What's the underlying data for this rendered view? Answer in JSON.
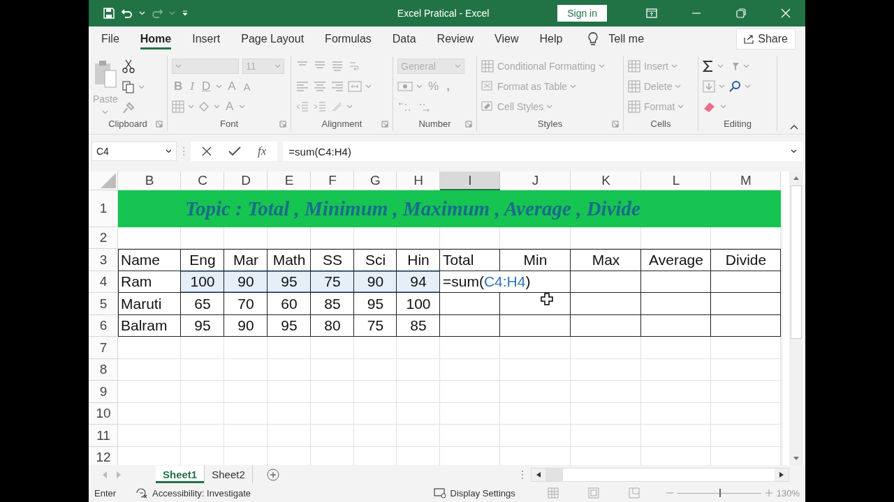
{
  "title_bar": {
    "title": "Excel Pratical  -  Excel",
    "sign_in": "Sign in"
  },
  "tabs": [
    {
      "label": "File",
      "selected": false
    },
    {
      "label": "Home",
      "selected": true
    },
    {
      "label": "Insert",
      "selected": false
    },
    {
      "label": "Page Layout",
      "selected": false
    },
    {
      "label": "Formulas",
      "selected": false
    },
    {
      "label": "Data",
      "selected": false
    },
    {
      "label": "Review",
      "selected": false
    },
    {
      "label": "View",
      "selected": false
    },
    {
      "label": "Help",
      "selected": false
    }
  ],
  "tell_me": "Tell me",
  "share": "Share",
  "ribbon": {
    "disabled": true,
    "paste": "Paste",
    "font_size": "11",
    "font_buttons": [
      "B",
      "I",
      "D",
      "A",
      "A"
    ],
    "font_color": "A",
    "number_format": "General",
    "percent": "%",
    "comma": ",",
    "styles": [
      "Conditional Formatting",
      "Format as Table",
      "Cell Styles"
    ],
    "cells": [
      "Insert",
      "Delete",
      "Format"
    ],
    "groups": [
      "Clipboard",
      "Font",
      "Alignment",
      "Number",
      "Styles",
      "Cells",
      "Editing"
    ]
  },
  "formula_bar": {
    "name_box": "C4",
    "fx": "fx",
    "formula": "=sum(C4:H4)"
  },
  "sheet": {
    "columns": [
      {
        "label": "B",
        "selected": false
      },
      {
        "label": "C",
        "selected": false
      },
      {
        "label": "D",
        "selected": false
      },
      {
        "label": "E",
        "selected": false
      },
      {
        "label": "F",
        "selected": false
      },
      {
        "label": "G",
        "selected": false
      },
      {
        "label": "H",
        "selected": false
      },
      {
        "label": "I",
        "selected": true
      },
      {
        "label": "J",
        "selected": false
      },
      {
        "label": "K",
        "selected": false
      },
      {
        "label": "L",
        "selected": false
      },
      {
        "label": "M",
        "selected": false
      }
    ],
    "rows": [
      {
        "number": "1",
        "kind": "title",
        "title": "Topic : Total , Minimum , Maximum , Average , Divide"
      },
      {
        "number": "2",
        "kind": "blank"
      },
      {
        "number": "3",
        "kind": "data",
        "cells": [
          {
            "text": "Name",
            "selected": false
          },
          {
            "text": "Eng",
            "selected": false
          },
          {
            "text": "Mar",
            "selected": false
          },
          {
            "text": "Math",
            "selected": false
          },
          {
            "text": "SS",
            "selected": false
          },
          {
            "text": "Sci",
            "selected": false
          },
          {
            "text": "Hin",
            "selected": false
          },
          {
            "text": "Total",
            "selected": false
          },
          {
            "text": "Min",
            "selected": false
          },
          {
            "text": "Max",
            "selected": false
          },
          {
            "text": "Average",
            "selected": false
          },
          {
            "text": "Divide",
            "selected": false
          }
        ]
      },
      {
        "number": "4",
        "kind": "data",
        "cells": [
          {
            "text": "Ram",
            "selected": false
          },
          {
            "text": "100",
            "selected": true
          },
          {
            "text": "90",
            "selected": true
          },
          {
            "text": "95",
            "selected": true
          },
          {
            "text": "75",
            "selected": true
          },
          {
            "text": "90",
            "selected": true
          },
          {
            "text": "94",
            "selected": true
          }
        ],
        "editing": [
          {
            "text": "=sum(",
            "ref": false
          },
          {
            "text": "C4:H4",
            "ref": true
          },
          {
            "text": ")",
            "ref": false
          }
        ]
      },
      {
        "number": "5",
        "kind": "data",
        "cells": [
          {
            "text": "Maruti",
            "selected": false
          },
          {
            "text": "65",
            "selected": false
          },
          {
            "text": "70",
            "selected": false
          },
          {
            "text": "60",
            "selected": false
          },
          {
            "text": "85",
            "selected": false
          },
          {
            "text": "95",
            "selected": false
          },
          {
            "text": "100",
            "selected": false
          }
        ]
      },
      {
        "number": "6",
        "kind": "data",
        "cells": [
          {
            "text": "Balram",
            "selected": false
          },
          {
            "text": "95",
            "selected": false
          },
          {
            "text": "90",
            "selected": false
          },
          {
            "text": "95",
            "selected": false
          },
          {
            "text": "80",
            "selected": false
          },
          {
            "text": "75",
            "selected": false
          },
          {
            "text": "85",
            "selected": false
          }
        ]
      },
      {
        "number": "7",
        "kind": "blank"
      },
      {
        "number": "8",
        "kind": "blank"
      },
      {
        "number": "9",
        "kind": "blank"
      },
      {
        "number": "10",
        "kind": "blank"
      },
      {
        "number": "11",
        "kind": "blank"
      },
      {
        "number": "12",
        "kind": "blank"
      }
    ]
  },
  "sheet_tabs": [
    {
      "label": "Sheet1",
      "selected": true
    },
    {
      "label": "Sheet2",
      "selected": false
    }
  ],
  "status_bar": {
    "mode": "Enter",
    "accessibility": "Accessibility: Investigate",
    "display_settings": "Display Settings",
    "zoom": {
      "level": 0.5,
      "reading": "130%"
    }
  }
}
